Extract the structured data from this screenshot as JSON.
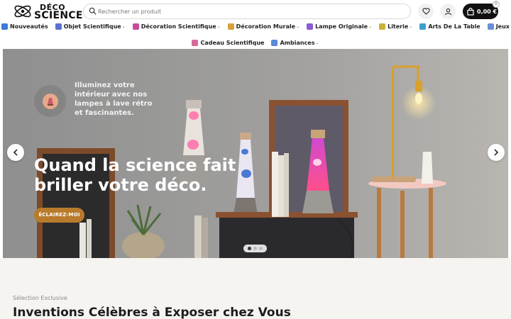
{
  "logo": {
    "line1": "DÉCO",
    "line2": "SCIENCE"
  },
  "search": {
    "placeholder": "Rechercher un produit"
  },
  "header_icons": {
    "wishlist": "heart-icon",
    "account": "user-icon",
    "cart": "shopping-bag-icon"
  },
  "cart": {
    "total": "0,00 €",
    "count": "0"
  },
  "nav": {
    "row1": [
      {
        "label": "Nouveautés",
        "icon": "sparkle-icon",
        "color": "#3b7bd6",
        "has_dropdown": false
      },
      {
        "label": "Objet Scientifique",
        "icon": "telescope-icon",
        "color": "#5b6fd6",
        "has_dropdown": true
      },
      {
        "label": "Décoration Scientifique",
        "icon": "lava-lamp-icon",
        "color": "#c94a9b",
        "has_dropdown": true
      },
      {
        "label": "Décoration Murale",
        "icon": "frame-icon",
        "color": "#d6a13b",
        "has_dropdown": true
      },
      {
        "label": "Lampe Originale",
        "icon": "globe-lamp-icon",
        "color": "#8a5bd6",
        "has_dropdown": true
      },
      {
        "label": "Literie",
        "icon": "pillow-icon",
        "color": "#c9b23a",
        "has_dropdown": true
      },
      {
        "label": "Arts De La Table",
        "icon": "bottle-icon",
        "color": "#3aa0c9",
        "has_dropdown": false
      },
      {
        "label": "Jeux",
        "icon": "gift-icon",
        "color": "#6a8ed6",
        "has_dropdown": false
      }
    ],
    "row2": [
      {
        "label": "Cadeau Scientifique",
        "icon": "gift-box-icon",
        "color": "#d66a9b",
        "has_dropdown": false
      },
      {
        "label": "Ambiances",
        "icon": "snowflake-icon",
        "color": "#5a8ad6",
        "has_dropdown": true
      }
    ]
  },
  "hero": {
    "intro": "Illuminez votre intérieur avec nos lampes à lave rétro et fascinantes.",
    "headline": "Quand la science fait briller votre déco.",
    "cta": "ÉCLAIREZ-MOI",
    "slides_total": 3,
    "active_slide": 1
  },
  "section": {
    "eyebrow": "Sélection Exclusive",
    "title": "Inventions Célèbres à Exposer chez Vous"
  },
  "colors": {
    "accent": "#b87b2c",
    "cart_bg": "#111111",
    "section_bg": "#f6f4f1"
  }
}
